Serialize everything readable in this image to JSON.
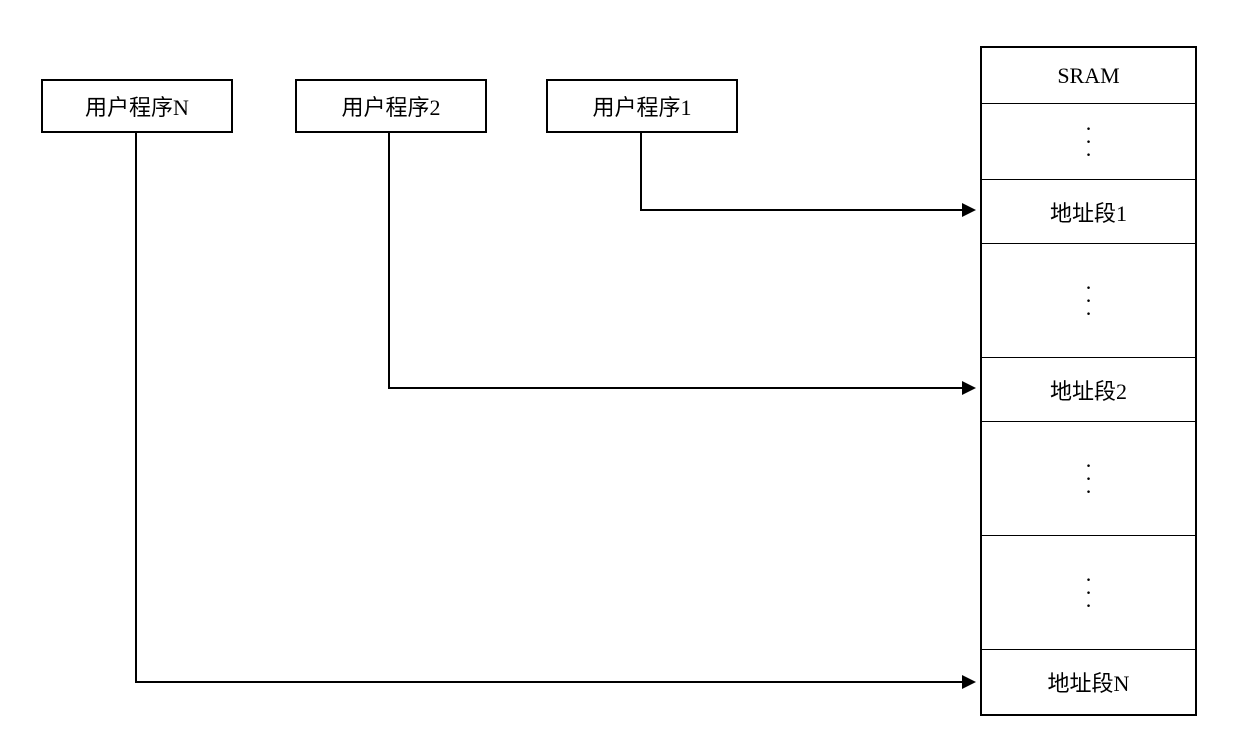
{
  "user_programs": {
    "n": "用户程序N",
    "p2": "用户程序2",
    "p1": "用户程序1"
  },
  "sram": {
    "header": "SRAM",
    "seg1": "地址段1",
    "seg2": "地址段2",
    "segn": "地址段N"
  }
}
